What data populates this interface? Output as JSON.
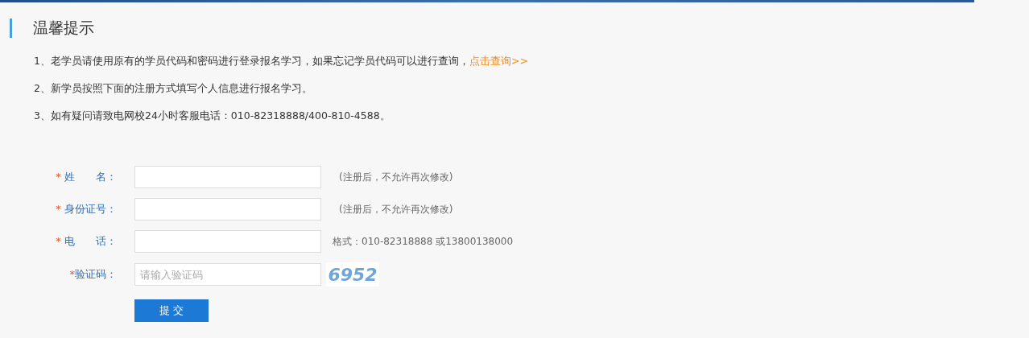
{
  "notice": {
    "title": "温馨提示",
    "items": [
      {
        "text": "1、老学员请使用原有的学员代码和密码进行登录报名学习，如果忘记学员代码可以进行查询，",
        "link": "点击查询>>"
      },
      {
        "text": "2、新学员按照下面的注册方式填写个人信息进行报名学习。"
      },
      {
        "text": "3、如有疑问请致电网校24小时客服电话：010-82318888/400-810-4588。"
      }
    ]
  },
  "form": {
    "fields": [
      {
        "required": "*",
        "label": "姓　　名：",
        "hint": "(注册后，不允许再次修改)",
        "kind": "text"
      },
      {
        "required": "*",
        "label": "身份证号：",
        "hint": "(注册后，不允许再次修改)",
        "kind": "text"
      },
      {
        "required": "*",
        "label": "电　　话：",
        "hint": "格式：010-82318888 或13800138000",
        "kind": "text"
      },
      {
        "required": "*",
        "label": "验证码：",
        "placeholder": "请输入验证码",
        "captcha": "6952",
        "kind": "captcha"
      }
    ],
    "submit": "提 交"
  }
}
